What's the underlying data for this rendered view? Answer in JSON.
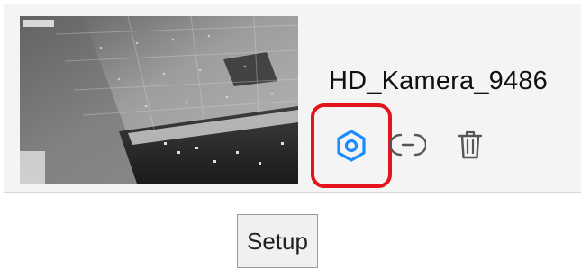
{
  "camera": {
    "name": "HD_Kamera_9486",
    "thumbnail_icon": "camera-preview-image",
    "overlay_text": "■■■■"
  },
  "actions": {
    "setup": {
      "icon": "hexagon-gear-icon",
      "color": "#1a8cff"
    },
    "disconnect": {
      "icon": "minus-circle-icon",
      "color": "#555555"
    },
    "delete": {
      "icon": "trash-icon",
      "color": "#555555"
    },
    "highlight_color": "#e3141c"
  },
  "tooltip": {
    "text": "Setup"
  }
}
